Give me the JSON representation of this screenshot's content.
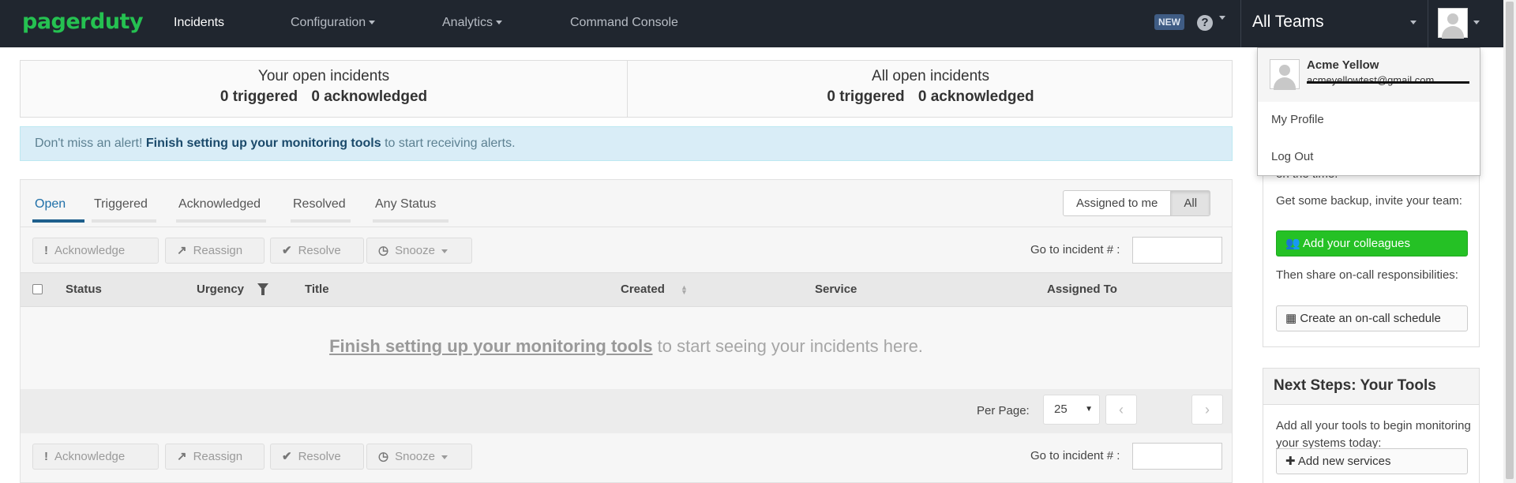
{
  "nav": {
    "logo": "pagerduty",
    "items": [
      "Incidents",
      "Configuration",
      "Analytics",
      "Command Console"
    ],
    "new_badge": "NEW",
    "help_glyph": "?",
    "teams": "All Teams"
  },
  "summary": {
    "left": {
      "title": "Your open incidents",
      "triggered": "0 triggered",
      "acknowledged": "0 acknowledged"
    },
    "right": {
      "title": "All open incidents",
      "triggered": "0 triggered",
      "acknowledged": "0 acknowledged"
    }
  },
  "alert": {
    "prefix": "Don't miss an alert!",
    "link": "Finish setting up your monitoring tools",
    "suffix": "to start receiving alerts."
  },
  "tabs": [
    "Open",
    "Triggered",
    "Acknowledged",
    "Resolved",
    "Any Status"
  ],
  "assign_toggle": [
    "Assigned to me",
    "All"
  ],
  "actions": {
    "acknowledge": "Acknowledge",
    "reassign": "Reassign",
    "resolve": "Resolve",
    "snooze": "Snooze"
  },
  "goto_label": "Go to incident # :",
  "columns": [
    "Status",
    "Urgency",
    "Title",
    "Created",
    "Service",
    "Assigned To"
  ],
  "empty": {
    "link": "Finish setting up your monitoring tools",
    "suffix": "to start seeing your incidents here."
  },
  "pagination": {
    "label": "Per Page:",
    "value": "25",
    "prev": "‹",
    "next": "›"
  },
  "sidebar": {
    "partial_text": "en the time.",
    "backup_text": "Get some backup, invite your team:",
    "add_colleagues": "Add your colleagues",
    "share_text": "Then share on-call responsibilities:",
    "create_schedule": "Create an on-call schedule",
    "next_title": "Next Steps: Your Tools",
    "tools_text": "Add all your tools to begin monitoring your systems today:",
    "add_services": "Add new services"
  },
  "dropdown": {
    "name": "Acme Yellow",
    "email": "acmeyellowtest@gmail.com",
    "items": [
      "My Profile",
      "Log Out"
    ]
  },
  "colors": {
    "nav_bg": "#20262f",
    "brand": "#25c151",
    "link": "#1e6fa8",
    "alert_bg": "#d9edf7",
    "green_btn": "#25c125"
  }
}
